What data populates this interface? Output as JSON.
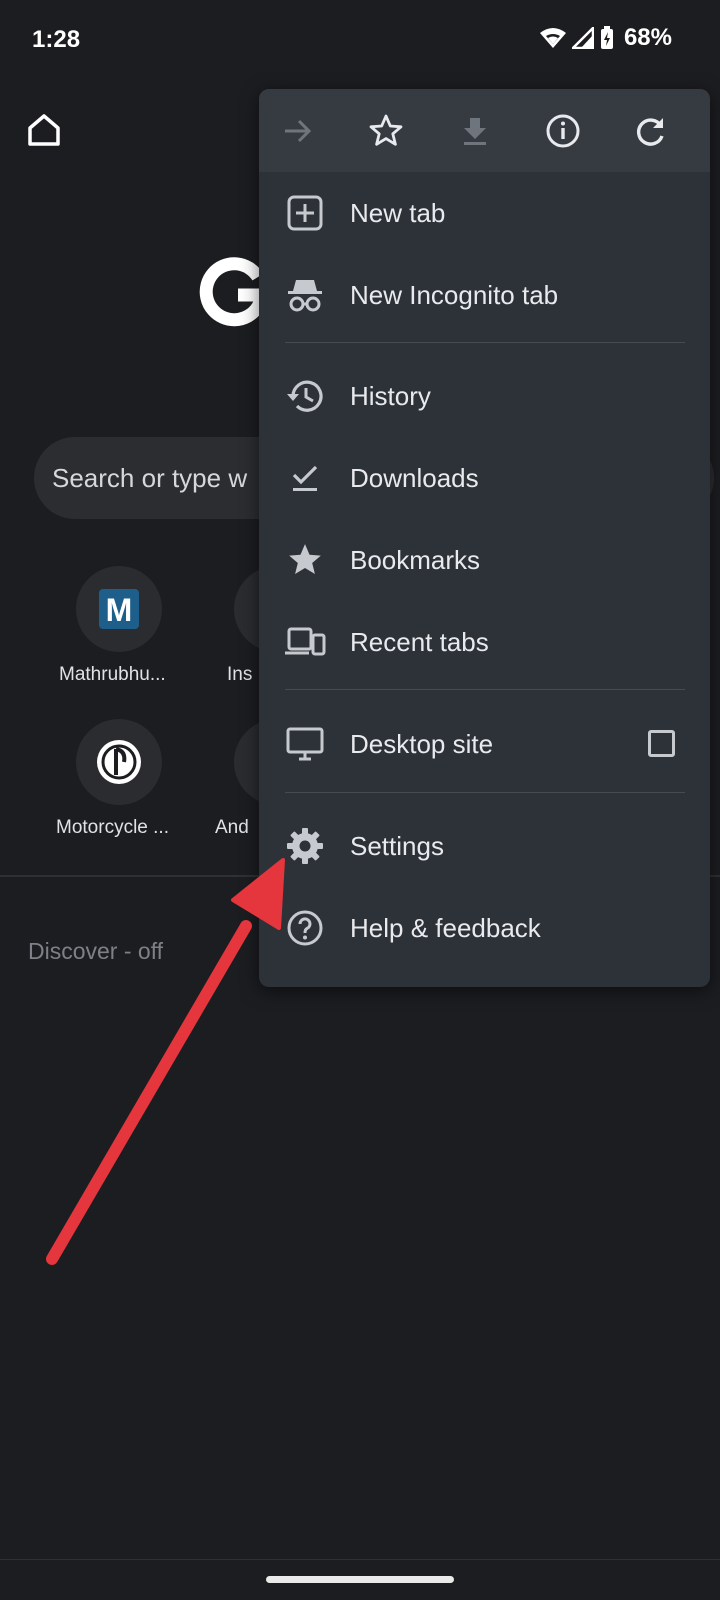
{
  "status_bar": {
    "time": "1:28",
    "battery": "68%"
  },
  "search": {
    "placeholder": "Search or type w"
  },
  "shortcuts": [
    {
      "label": "Mathrubhu...",
      "icon": "M"
    },
    {
      "label": "Ins"
    },
    {
      "label": "Motorcycle ..."
    },
    {
      "label": "And"
    }
  ],
  "feed": {
    "discover": "Discover - off"
  },
  "menu": {
    "toolbar": [
      "forward-icon",
      "bookmark-star-icon",
      "download-icon",
      "info-icon",
      "refresh-icon"
    ],
    "items": [
      {
        "label": "New tab"
      },
      {
        "label": "New Incognito tab"
      },
      {
        "label": "History"
      },
      {
        "label": "Downloads"
      },
      {
        "label": "Bookmarks"
      },
      {
        "label": "Recent tabs"
      },
      {
        "label": "Desktop site",
        "checked": false
      },
      {
        "label": "Settings"
      },
      {
        "label": "Help & feedback"
      }
    ]
  },
  "colors": {
    "background": "#1c1d21",
    "menu": "#2d3238",
    "arrow": "#e5363d"
  }
}
